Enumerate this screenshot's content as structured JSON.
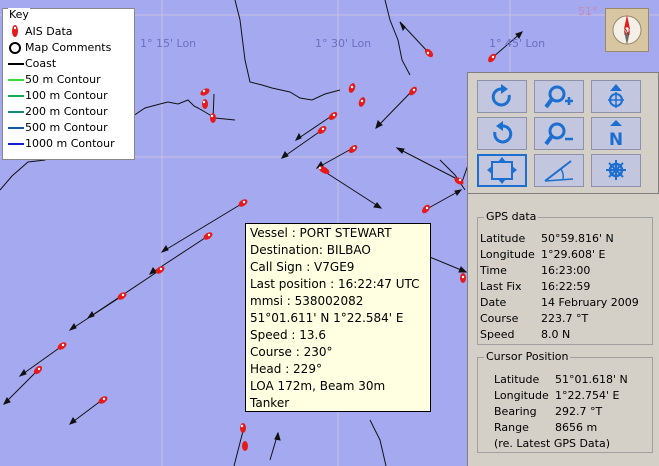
{
  "map": {
    "lon_labels": [
      "1° 15' Lon",
      "1° 30' Lon",
      "1° 45' Lon"
    ],
    "lat_label": "51°"
  },
  "key": {
    "title": "Key",
    "items": [
      {
        "label": "AIS Data",
        "color": "#e51b1b",
        "kind": "ais"
      },
      {
        "label": "Map Comments",
        "color": "#000000",
        "kind": "circle"
      },
      {
        "label": "Coast",
        "color": "#000000",
        "kind": "line"
      },
      {
        "label": "50 m Contour",
        "color": "#33dd33",
        "kind": "line"
      },
      {
        "label": "100 m Contour",
        "color": "#11aa55",
        "kind": "line"
      },
      {
        "label": "200 m Contour",
        "color": "#118877",
        "kind": "line"
      },
      {
        "label": "500 m Contour",
        "color": "#1155aa",
        "kind": "line"
      },
      {
        "label": "1000 m Contour",
        "color": "#1122cc",
        "kind": "line"
      }
    ]
  },
  "compass": {
    "label": "N",
    "icon": "compass-rose-icon"
  },
  "controls": [
    {
      "name": "rotate-clockwise-button",
      "icon": "rotate-clockwise-icon"
    },
    {
      "name": "zoom-in-button",
      "icon": "zoom-in-icon"
    },
    {
      "name": "north-up-helm-button",
      "icon": "north-up-helm-icon"
    },
    {
      "name": "rotate-counterclockwise-button",
      "icon": "rotate-counterclockwise-icon"
    },
    {
      "name": "zoom-out-button",
      "icon": "zoom-out-icon"
    },
    {
      "name": "north-up-button",
      "icon": "north-up-icon"
    },
    {
      "name": "fit-extent-button",
      "icon": "fit-extent-icon"
    },
    {
      "name": "measure-bearing-button",
      "icon": "measure-bearing-icon"
    },
    {
      "name": "helm-button",
      "icon": "ship-wheel-icon"
    }
  ],
  "gps": {
    "title": "GPS data",
    "rows": [
      {
        "label": "Latitude",
        "value": "50°59.816' N"
      },
      {
        "label": "Longitude",
        "value": "1°29.608' E"
      },
      {
        "label": "Time",
        "value": "16:23:00"
      },
      {
        "label": "Last Fix",
        "value": "16:22:59"
      },
      {
        "label": "Date",
        "value": "14 February 2009"
      },
      {
        "label": "Course",
        "value": "223.7 °T"
      },
      {
        "label": "Speed",
        "value": "8.0 N"
      }
    ]
  },
  "cursor": {
    "title": "Cursor Position",
    "rows": [
      {
        "label": "Latitude",
        "value": "51°01.618' N"
      },
      {
        "label": "Longitude",
        "value": "1°22.754' E"
      },
      {
        "label": "Bearing",
        "value": "292.7 °T"
      },
      {
        "label": "Range",
        "value": "8656 m"
      }
    ],
    "note": "(re. Latest GPS Data)"
  },
  "tooltip": {
    "lines": [
      "Vessel : PORT STEWART",
      "Destination: BILBAO",
      "Call Sign : V7GE9",
      "Last position : 16:22:47 UTC",
      "mmsi : 538002082",
      "51°01.611' N 1°22.584' E",
      "Speed : 13.6",
      "Course : 230°",
      "Head : 229°",
      "LOA 172m, Beam 30m",
      "Tanker"
    ]
  }
}
